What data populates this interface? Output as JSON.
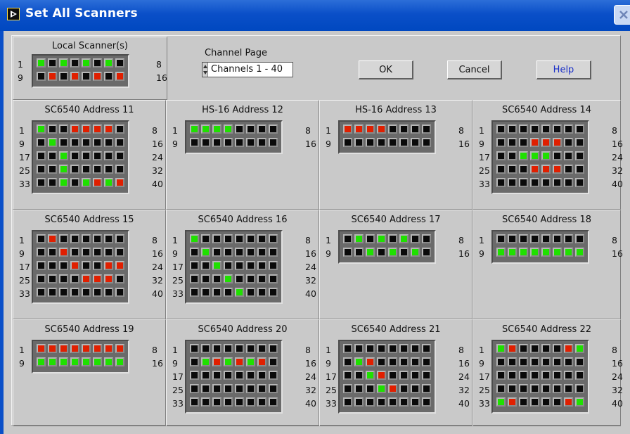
{
  "window": {
    "title": "Set All Scanners",
    "title_icon": "labview-run-icon",
    "close_icon": "close-icon"
  },
  "local_scanner": {
    "title": "Local Scanner(s)",
    "rows": [
      {
        "left": "1",
        "right": "8",
        "leds": [
          "g",
          "k",
          "g",
          "k",
          "g",
          "k",
          "g",
          "k"
        ]
      },
      {
        "left": "9",
        "right": "16",
        "leds": [
          "k",
          "r",
          "k",
          "r",
          "k",
          "r",
          "k",
          "r"
        ]
      }
    ]
  },
  "channel_page": {
    "label": "Channel Page",
    "value": "Channels 1 - 40"
  },
  "buttons": {
    "ok": "OK",
    "cancel": "Cancel",
    "help": "Help"
  },
  "colors": {
    "on_green": "#1fe000",
    "on_red": "#e01f00",
    "off": "#0a0a0a",
    "panel_bg": "#c9c9c9",
    "titlebar": "#0a4fc8"
  },
  "scanners": [
    {
      "title": "SC6540 Address 11",
      "rows": [
        {
          "left": "1",
          "right": "8",
          "leds": [
            "g",
            "k",
            "k",
            "r",
            "r",
            "r",
            "r",
            "k"
          ]
        },
        {
          "left": "9",
          "right": "16",
          "leds": [
            "k",
            "g",
            "k",
            "k",
            "k",
            "k",
            "k",
            "k"
          ]
        },
        {
          "left": "17",
          "right": "24",
          "leds": [
            "k",
            "k",
            "g",
            "k",
            "k",
            "k",
            "k",
            "k"
          ]
        },
        {
          "left": "25",
          "right": "32",
          "leds": [
            "k",
            "k",
            "g",
            "k",
            "k",
            "k",
            "k",
            "k"
          ]
        },
        {
          "left": "33",
          "right": "40",
          "leds": [
            "k",
            "k",
            "g",
            "k",
            "g",
            "r",
            "g",
            "r"
          ]
        }
      ]
    },
    {
      "title": "HS-16 Address 12",
      "rows": [
        {
          "left": "1",
          "right": "8",
          "leds": [
            "g",
            "g",
            "g",
            "g",
            "k",
            "k",
            "k",
            "k"
          ]
        },
        {
          "left": "9",
          "right": "16",
          "leds": [
            "k",
            "k",
            "k",
            "k",
            "k",
            "k",
            "k",
            "k"
          ]
        }
      ]
    },
    {
      "title": "HS-16 Address 13",
      "rows": [
        {
          "left": "1",
          "right": "8",
          "leds": [
            "r",
            "r",
            "r",
            "r",
            "k",
            "k",
            "k",
            "k"
          ]
        },
        {
          "left": "9",
          "right": "16",
          "leds": [
            "k",
            "k",
            "k",
            "k",
            "k",
            "k",
            "k",
            "k"
          ]
        }
      ]
    },
    {
      "title": "SC6540 Address 14",
      "rows": [
        {
          "left": "1",
          "right": "8",
          "leds": [
            "k",
            "k",
            "k",
            "k",
            "k",
            "k",
            "k",
            "k"
          ]
        },
        {
          "left": "9",
          "right": "16",
          "leds": [
            "k",
            "k",
            "k",
            "r",
            "r",
            "r",
            "k",
            "k"
          ]
        },
        {
          "left": "17",
          "right": "24",
          "leds": [
            "k",
            "k",
            "g",
            "g",
            "g",
            "k",
            "k",
            "k"
          ]
        },
        {
          "left": "25",
          "right": "32",
          "leds": [
            "k",
            "k",
            "k",
            "r",
            "r",
            "r",
            "k",
            "k"
          ]
        },
        {
          "left": "33",
          "right": "40",
          "leds": [
            "k",
            "k",
            "k",
            "k",
            "k",
            "k",
            "k",
            "k"
          ]
        }
      ]
    },
    {
      "title": "SC6540 Address 15",
      "rows": [
        {
          "left": "1",
          "right": "8",
          "leds": [
            "k",
            "r",
            "k",
            "k",
            "k",
            "k",
            "k",
            "k"
          ]
        },
        {
          "left": "9",
          "right": "16",
          "leds": [
            "k",
            "k",
            "r",
            "k",
            "k",
            "k",
            "k",
            "k"
          ]
        },
        {
          "left": "17",
          "right": "24",
          "leds": [
            "k",
            "k",
            "k",
            "r",
            "k",
            "k",
            "r",
            "r"
          ]
        },
        {
          "left": "25",
          "right": "32",
          "leds": [
            "k",
            "k",
            "k",
            "k",
            "r",
            "r",
            "r",
            "k"
          ]
        },
        {
          "left": "33",
          "right": "40",
          "leds": [
            "k",
            "k",
            "k",
            "k",
            "k",
            "k",
            "k",
            "k"
          ]
        }
      ]
    },
    {
      "title": "SC6540 Address 16",
      "rows": [
        {
          "left": "1",
          "right": "8",
          "leds": [
            "g",
            "k",
            "k",
            "k",
            "k",
            "k",
            "k",
            "k"
          ]
        },
        {
          "left": "9",
          "right": "16",
          "leds": [
            "k",
            "g",
            "k",
            "k",
            "k",
            "k",
            "k",
            "k"
          ]
        },
        {
          "left": "17",
          "right": "24",
          "leds": [
            "k",
            "k",
            "g",
            "k",
            "k",
            "k",
            "k",
            "k"
          ]
        },
        {
          "left": "25",
          "right": "32",
          "leds": [
            "k",
            "k",
            "k",
            "g",
            "k",
            "k",
            "k",
            "k"
          ]
        },
        {
          "left": "33",
          "right": "40",
          "leds": [
            "k",
            "k",
            "k",
            "k",
            "g",
            "k",
            "k",
            "k"
          ]
        }
      ]
    },
    {
      "title": "SC6540 Address 17",
      "rows": [
        {
          "left": "1",
          "right": "8",
          "leds": [
            "k",
            "g",
            "k",
            "g",
            "k",
            "g",
            "k",
            "k"
          ]
        },
        {
          "left": "9",
          "right": "16",
          "leds": [
            "k",
            "k",
            "g",
            "k",
            "g",
            "k",
            "g",
            "k"
          ]
        }
      ]
    },
    {
      "title": "SC6540 Address 18",
      "rows": [
        {
          "left": "1",
          "right": "8",
          "leds": [
            "k",
            "k",
            "k",
            "k",
            "k",
            "k",
            "k",
            "k"
          ]
        },
        {
          "left": "9",
          "right": "16",
          "leds": [
            "g",
            "g",
            "g",
            "g",
            "g",
            "g",
            "g",
            "g"
          ]
        }
      ]
    },
    {
      "title": "SC6540 Address 19",
      "rows": [
        {
          "left": "1",
          "right": "8",
          "leds": [
            "r",
            "r",
            "r",
            "r",
            "r",
            "r",
            "r",
            "r"
          ]
        },
        {
          "left": "9",
          "right": "16",
          "leds": [
            "g",
            "g",
            "g",
            "g",
            "g",
            "g",
            "g",
            "g"
          ]
        }
      ]
    },
    {
      "title": "SC6540 Address 20",
      "rows": [
        {
          "left": "1",
          "right": "8",
          "leds": [
            "k",
            "k",
            "k",
            "k",
            "k",
            "k",
            "k",
            "k"
          ]
        },
        {
          "left": "9",
          "right": "16",
          "leds": [
            "k",
            "g",
            "r",
            "g",
            "r",
            "g",
            "r",
            "k"
          ]
        },
        {
          "left": "17",
          "right": "24",
          "leds": [
            "k",
            "k",
            "k",
            "k",
            "k",
            "k",
            "k",
            "k"
          ]
        },
        {
          "left": "25",
          "right": "32",
          "leds": [
            "k",
            "k",
            "k",
            "k",
            "k",
            "k",
            "k",
            "k"
          ]
        },
        {
          "left": "33",
          "right": "40",
          "leds": [
            "k",
            "k",
            "k",
            "k",
            "k",
            "k",
            "k",
            "k"
          ]
        }
      ]
    },
    {
      "title": "SC6540 Address 21",
      "rows": [
        {
          "left": "1",
          "right": "8",
          "leds": [
            "k",
            "k",
            "k",
            "k",
            "k",
            "k",
            "k",
            "k"
          ]
        },
        {
          "left": "9",
          "right": "16",
          "leds": [
            "k",
            "g",
            "r",
            "k",
            "k",
            "k",
            "k",
            "k"
          ]
        },
        {
          "left": "17",
          "right": "24",
          "leds": [
            "k",
            "k",
            "g",
            "r",
            "k",
            "k",
            "k",
            "k"
          ]
        },
        {
          "left": "25",
          "right": "32",
          "leds": [
            "k",
            "k",
            "k",
            "g",
            "r",
            "k",
            "k",
            "k"
          ]
        },
        {
          "left": "33",
          "right": "40",
          "leds": [
            "k",
            "k",
            "k",
            "k",
            "k",
            "k",
            "k",
            "k"
          ]
        }
      ]
    },
    {
      "title": "SC6540 Address 22",
      "rows": [
        {
          "left": "1",
          "right": "8",
          "leds": [
            "g",
            "r",
            "k",
            "k",
            "k",
            "k",
            "r",
            "g"
          ]
        },
        {
          "left": "9",
          "right": "16",
          "leds": [
            "k",
            "k",
            "k",
            "k",
            "k",
            "k",
            "k",
            "k"
          ]
        },
        {
          "left": "17",
          "right": "24",
          "leds": [
            "k",
            "k",
            "k",
            "k",
            "k",
            "k",
            "k",
            "k"
          ]
        },
        {
          "left": "25",
          "right": "32",
          "leds": [
            "k",
            "k",
            "k",
            "k",
            "k",
            "k",
            "k",
            "k"
          ]
        },
        {
          "left": "33",
          "right": "40",
          "leds": [
            "g",
            "r",
            "k",
            "k",
            "k",
            "k",
            "r",
            "g"
          ]
        }
      ]
    }
  ]
}
